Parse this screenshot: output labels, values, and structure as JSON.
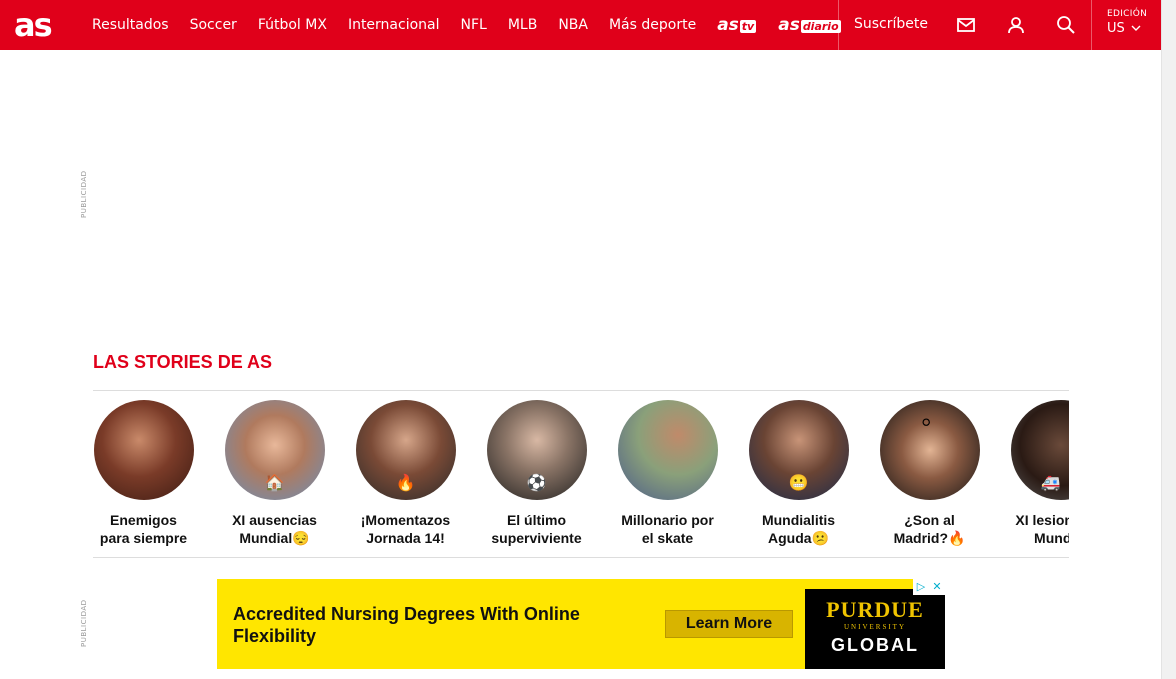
{
  "brand": {
    "logo": "as",
    "accent": "#e0001a"
  },
  "nav": {
    "items": [
      "Resultados",
      "Soccer",
      "Fútbol MX",
      "Internacional",
      "NFL",
      "MLB",
      "NBA",
      "Más deporte"
    ],
    "astv": {
      "prefix": "as",
      "tag": "tv"
    },
    "asdiario": {
      "prefix": "as",
      "tag": "diario"
    }
  },
  "header": {
    "subscribe": "Suscríbete",
    "icons": [
      "mail-icon",
      "user-icon",
      "search-icon"
    ],
    "edition_label": "EDICIÓN",
    "edition_value": "US"
  },
  "ad_labels": {
    "publicidad": "PUBLICIDAD"
  },
  "stories": {
    "title": "LAS STORIES DE AS",
    "items": [
      {
        "line1": "Enemigos",
        "line2": "para siempre",
        "emoji": "",
        "color": "#8c3a2a"
      },
      {
        "line1": "XI ausencias",
        "line2": "Mundial😔",
        "emoji": "🏠",
        "color": "#9a6b55"
      },
      {
        "line1": "¡Momentazos",
        "line2": "Jornada 14!",
        "emoji": "🔥",
        "color": "#6b4a3a"
      },
      {
        "line1": "El último",
        "line2": "superviviente",
        "emoji": "⚽",
        "color": "#3a3a3a"
      },
      {
        "line1": "Millonario por",
        "line2": "el skate",
        "emoji": "",
        "color": "#6f8a5a"
      },
      {
        "line1": "Mundialitis",
        "line2": "Aguda😕",
        "emoji": "😬",
        "color": "#4a3a3a"
      },
      {
        "line1": "¿Son al",
        "line2": "Madrid?🔥",
        "emoji": "⚪",
        "color": "#2d2d2d"
      },
      {
        "line1": "XI lesionados",
        "line2": "Mundial",
        "emoji": "🚑",
        "color": "#5a4a40"
      }
    ]
  },
  "ad": {
    "headline": "Accredited Nursing Degrees With Online Flexibility",
    "button": "Learn More",
    "brand_top": "PURDUE",
    "brand_mid": "UNIVERSITY",
    "brand_bot": "GLOBAL"
  }
}
